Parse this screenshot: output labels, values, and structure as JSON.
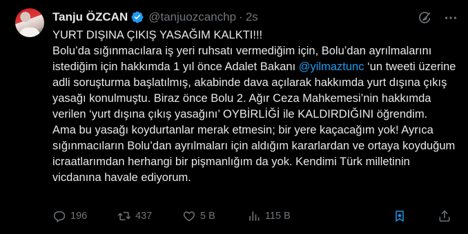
{
  "author": {
    "name": "Tanju ÖZCAN",
    "handle": "@tanjuozcanchp",
    "separator": "·",
    "time": "2s"
  },
  "icons": {
    "verified": "verified-badge-icon",
    "grok": "grok-icon",
    "more": "more-icon",
    "reply": "reply-icon",
    "retweet": "retweet-icon",
    "like": "heart-icon",
    "views": "views-icon",
    "bookmark": "bookmark-icon",
    "share": "share-icon"
  },
  "colors": {
    "background": "#000000",
    "text": "#e7e9ea",
    "muted": "#71767b",
    "link": "#1d9bf0"
  },
  "tweet": {
    "line1": "YURT DIŞINA ÇIKIŞ YASAĞIM KALKTI!!!",
    "para1_before_mention": "Bolu’da sığınmacılara iş yeri ruhsatı vermediğim için, Bolu’dan ayrılmalarını istediğim için hakkımda 1 yıl önce Adalet Bakanı ",
    "mention": "@yilmaztunc",
    "para1_after_mention": " ‘un tweeti üzerine adli soruşturma başlatılmış, akabinde dava açılarak hakkımda yurt dışına çıkış yasağı konulmuştu. Biraz önce Bolu 2. Ağır Ceza Mahkemesi’nin hakkımda verilen ‘yurt dışına çıkış yasağını’ OYBİRLİĞİ ile KALDIRDIĞINI öğrendim.",
    "para2": "Ama bu yasağı koydurtanlar merak etmesin; bir yere kaçacağım yok! Ayrıca sığınmacıların Bolu’dan ayrılmaları için aldığım kararlardan ve ortaya koyduğum icraatlarımdan herhangi bir pişmanlığım da yok. Kendimi Türk milletinin vicdanına havale ediyorum."
  },
  "actions": {
    "replies": "196",
    "retweets": "437",
    "likes": "5 B",
    "views": "115 B"
  }
}
